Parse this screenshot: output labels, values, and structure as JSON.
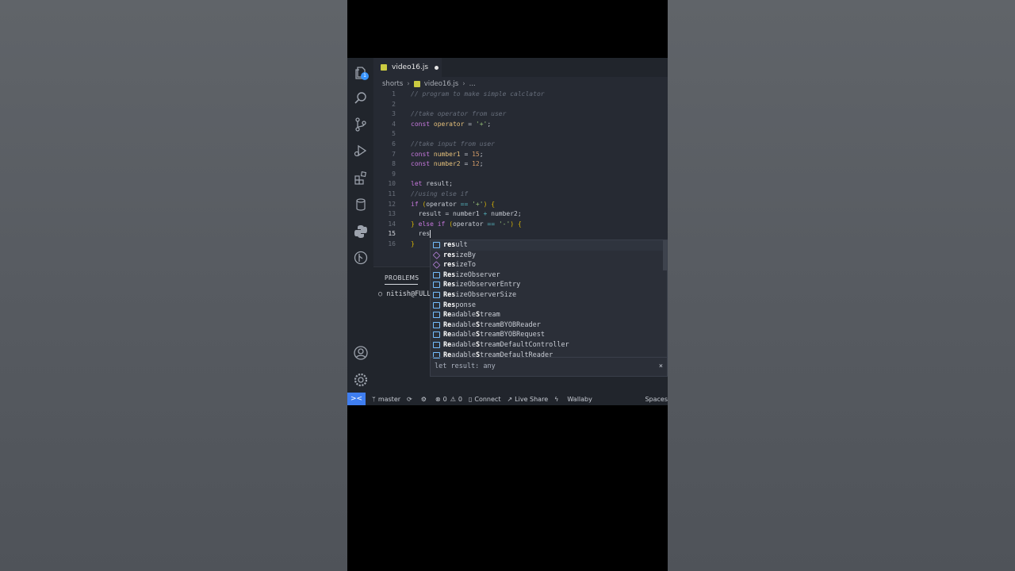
{
  "tab": {
    "filename": "video16.js"
  },
  "breadcrumb": {
    "folder": "shorts",
    "file": "video16.js",
    "more": "..."
  },
  "activity": {
    "explorer_badge": "1"
  },
  "code": {
    "lines": [
      {
        "n": "1",
        "segs": [
          {
            "c": "cmt",
            "t": "// program to make simple calclator"
          }
        ]
      },
      {
        "n": "2",
        "segs": []
      },
      {
        "n": "3",
        "segs": [
          {
            "c": "cmt",
            "t": "//take operator from user"
          }
        ]
      },
      {
        "n": "4",
        "segs": [
          {
            "c": "kw",
            "t": "const "
          },
          {
            "c": "var",
            "t": "operator"
          },
          {
            "c": "plain",
            "t": " = "
          },
          {
            "c": "str",
            "t": "'+'"
          },
          {
            "c": "plain",
            "t": ";"
          }
        ]
      },
      {
        "n": "5",
        "segs": []
      },
      {
        "n": "6",
        "segs": [
          {
            "c": "cmt",
            "t": "//take input from user"
          }
        ]
      },
      {
        "n": "7",
        "segs": [
          {
            "c": "kw",
            "t": "const "
          },
          {
            "c": "var",
            "t": "number1"
          },
          {
            "c": "plain",
            "t": " = "
          },
          {
            "c": "num",
            "t": "15"
          },
          {
            "c": "plain",
            "t": ";"
          }
        ]
      },
      {
        "n": "8",
        "segs": [
          {
            "c": "kw",
            "t": "const "
          },
          {
            "c": "var",
            "t": "number2"
          },
          {
            "c": "plain",
            "t": " = "
          },
          {
            "c": "num",
            "t": "12"
          },
          {
            "c": "plain",
            "t": ";"
          }
        ]
      },
      {
        "n": "9",
        "segs": []
      },
      {
        "n": "10",
        "segs": [
          {
            "c": "kw",
            "t": "let "
          },
          {
            "c": "plain",
            "t": "result;"
          }
        ]
      },
      {
        "n": "11",
        "segs": [
          {
            "c": "cmt",
            "t": "//using else if"
          }
        ]
      },
      {
        "n": "12",
        "segs": [
          {
            "c": "kw",
            "t": "if "
          },
          {
            "c": "br",
            "t": "("
          },
          {
            "c": "plain",
            "t": "operator "
          },
          {
            "c": "op",
            "t": "=="
          },
          {
            "c": "plain",
            "t": " "
          },
          {
            "c": "str",
            "t": "'+'"
          },
          {
            "c": "br",
            "t": ")"
          },
          {
            "c": "plain",
            "t": " "
          },
          {
            "c": "br",
            "t": "{"
          }
        ]
      },
      {
        "n": "13",
        "segs": [
          {
            "c": "plain",
            "t": "  result = number1 "
          },
          {
            "c": "op",
            "t": "+"
          },
          {
            "c": "plain",
            "t": " number2;"
          }
        ]
      },
      {
        "n": "14",
        "segs": [
          {
            "c": "br",
            "t": "}"
          },
          {
            "c": "kw",
            "t": " else if "
          },
          {
            "c": "br",
            "t": "("
          },
          {
            "c": "plain",
            "t": "operator "
          },
          {
            "c": "op",
            "t": "=="
          },
          {
            "c": "plain",
            "t": " "
          },
          {
            "c": "str",
            "t": "'-'"
          },
          {
            "c": "br",
            "t": ")"
          },
          {
            "c": "plain",
            "t": " "
          },
          {
            "c": "br",
            "t": "{"
          }
        ]
      },
      {
        "n": "15",
        "segs": [
          {
            "c": "plain",
            "t": "  res"
          }
        ],
        "active": true,
        "cursor": true
      },
      {
        "n": "16",
        "segs": [
          {
            "c": "br",
            "t": "}"
          }
        ]
      }
    ]
  },
  "panel": {
    "tab": "PROBLEMS",
    "terminal_line": "○ nitish@FULL7"
  },
  "suggest": {
    "items": [
      {
        "kind": "var",
        "bold": "res",
        "rest": "ult"
      },
      {
        "kind": "cube",
        "bold": "res",
        "rest": "izeBy"
      },
      {
        "kind": "cube",
        "bold": "res",
        "rest": "izeTo"
      },
      {
        "kind": "var",
        "bold": "Res",
        "rest": "izeObserver"
      },
      {
        "kind": "var",
        "bold": "Res",
        "rest": "izeObserverEntry"
      },
      {
        "kind": "var",
        "bold": "Res",
        "rest": "izeObserverSize"
      },
      {
        "kind": "var",
        "bold": "Res",
        "rest": "ponse"
      },
      {
        "kind": "var",
        "bold": "Re",
        "rest": "adable",
        "bold2": "S",
        "rest2": "tream"
      },
      {
        "kind": "var",
        "bold": "Re",
        "rest": "adable",
        "bold2": "S",
        "rest2": "treamBYOBReader"
      },
      {
        "kind": "var",
        "bold": "Re",
        "rest": "adable",
        "bold2": "S",
        "rest2": "treamBYOBRequest"
      },
      {
        "kind": "var",
        "bold": "Re",
        "rest": "adable",
        "bold2": "S",
        "rest2": "treamDefaultController"
      },
      {
        "kind": "var",
        "bold": "Re",
        "rest": "adable",
        "bold2": "S",
        "rest2": "treamDefaultReader"
      }
    ],
    "detail": "let result: any",
    "close": "×"
  },
  "status": {
    "remote": "><",
    "branch": "master",
    "errors": "0",
    "warnings": "0",
    "connect": "Connect",
    "liveshare": "Live Share",
    "wallaby": "Wallaby",
    "spaces": "Spaces"
  },
  "colors": {
    "accent": "#3f7ef0",
    "editor_bg": "#262a33",
    "sidebar_bg": "#21252c"
  }
}
